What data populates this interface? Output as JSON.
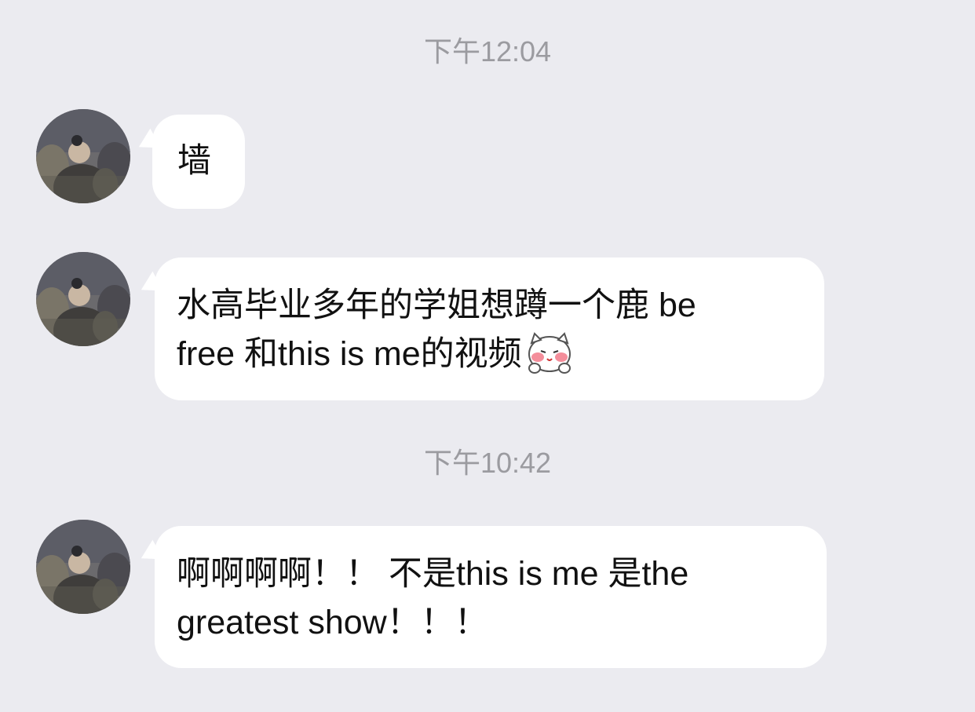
{
  "conversation": {
    "timestamps": [
      "下午12:04",
      "下午10:42"
    ],
    "messages": [
      {
        "lines": [
          "墙"
        ]
      },
      {
        "lines": [
          "水高毕业多年的学姐想蹲一个鹿 be",
          " free 和this is me的视频"
        ],
        "emoji": "blushing-cat-emoji"
      },
      {
        "lines": [
          "啊啊啊啊！！ 不是this is me 是the",
          "greatest show！！！"
        ]
      }
    ]
  },
  "colors": {
    "background": "#ebebf0",
    "bubble": "#ffffff",
    "timestamp_text": "#9b9ba0",
    "message_text": "#111111"
  },
  "icons": {
    "avatar": "user-avatar-photo",
    "emoji": "blushing-cat-emoji"
  }
}
